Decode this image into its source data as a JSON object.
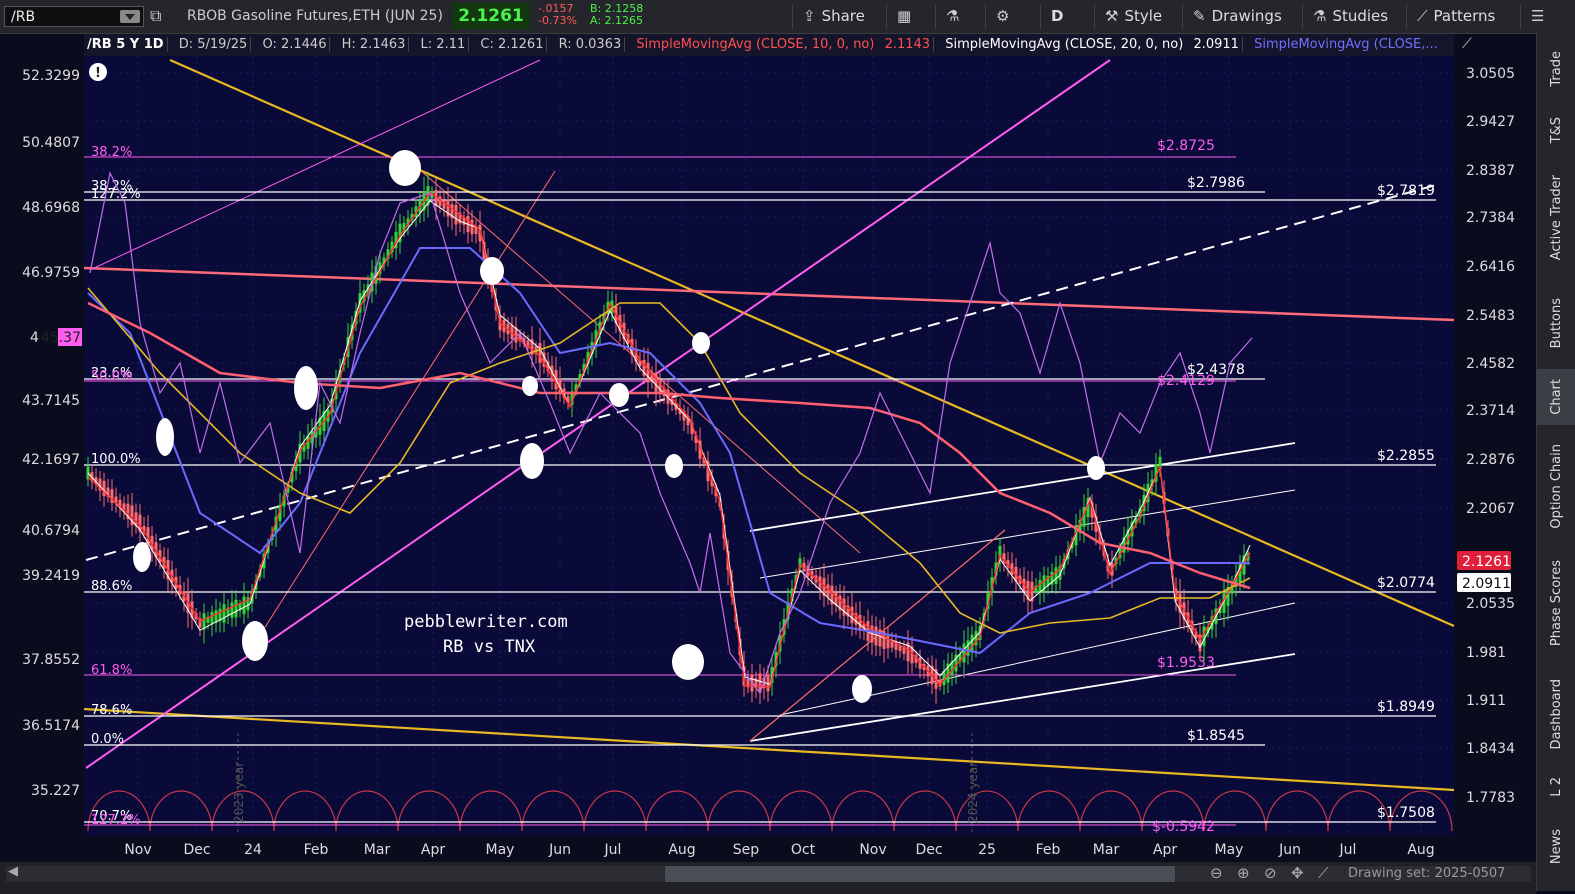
{
  "toolbar": {
    "symbol": "/RB",
    "description": "RBOB Gasoline Futures,ETH (JUN 25)",
    "last_price": "2.1261",
    "net_change": "-.0157",
    "pct_change": "-0.73%",
    "bid": "B: 2.1258",
    "ask": "A: 2.1265",
    "share": "Share",
    "aggregation": "D",
    "style": "Style",
    "drawings": "Drawings",
    "studies": "Studies",
    "patterns": "Patterns"
  },
  "header": {
    "title": "/RB 5 Y 1D",
    "date": "D: 5/19/25",
    "open": "O: 2.1446",
    "high": "H: 2.1463",
    "low": "L: 2.11",
    "close": "C: 2.1261",
    "range": "R: 0.0363",
    "sma10": "SimpleMovingAvg (CLOSE, 10, 0, no)",
    "sma10_val": "2.1143",
    "sma20": "SimpleMovingAvg (CLOSE, 20, 0, no)",
    "sma20_val": "2.0911",
    "sma_more": "SimpleMovingAvg (CLOSE,..."
  },
  "chart": {
    "left_axis": [
      "52.3299",
      "50.4807",
      "48.6968",
      "46.9759",
      "43.7145",
      "42.1697",
      "40.6794",
      "39.2419",
      "37.8552",
      "36.5174",
      "35.227"
    ],
    "left_marker": "45.37",
    "right_axis": [
      "3.0505",
      "2.9427",
      "2.8387",
      "2.7384",
      "2.6416",
      "2.5483",
      "2.4582",
      "2.3714",
      "2.2876",
      "2.2067",
      "2.0535",
      "1.981",
      "1.911",
      "1.8434",
      "1.7783"
    ],
    "price_tag": "2.1261",
    "sma_tag": "2.0911",
    "x_axis": [
      "Nov",
      "Dec",
      "24",
      "Feb",
      "Mar",
      "Apr",
      "May",
      "Jun",
      "Jul",
      "Aug",
      "Sep",
      "Oct",
      "Nov",
      "Dec",
      "25",
      "Feb",
      "Mar",
      "Apr",
      "May",
      "Jun",
      "Jul",
      "Aug"
    ],
    "year_labels": [
      "2023 year",
      "2024 year"
    ],
    "fib_white": [
      {
        "label": "38.2%",
        "right": "$2.7986"
      },
      {
        "label": "127.2%",
        "right": "$2.7819"
      },
      {
        "label": "23.6%",
        "right": "$2.4378"
      },
      {
        "label": "100.0%",
        "right": "$2.2855"
      },
      {
        "label": "88.6%",
        "right": "$2.0774"
      },
      {
        "label": "78.6%",
        "right": "$1.8949"
      },
      {
        "label": "0.0%",
        "right": "$1.8545"
      },
      {
        "label": "70.7%",
        "right": "$1.7508"
      }
    ],
    "fib_pink": [
      {
        "label": "38.2%",
        "right": "$2.8725"
      },
      {
        "label": "50.0%",
        "right": "$2.4129"
      },
      {
        "label": "61.8%",
        "right": "$1.9533"
      },
      {
        "label": "127.2%",
        "right": "$-0.5942"
      }
    ],
    "watermark_1": "pebblewriter.com",
    "watermark_2": "RB vs TNX"
  },
  "sidebar": [
    "Trade",
    "T&S",
    "Active Trader",
    "Buttons",
    "Chart",
    "Option Chain",
    "Phase Scores",
    "Dashboard",
    "L 2",
    "News"
  ],
  "footer": {
    "drawing_set": "Drawing set: 2025-0507"
  },
  "colors": {
    "bg": "#0b0b1e",
    "up": "#35d435",
    "down": "#ff6b6b",
    "gold": "#e8b923",
    "pink": "#ff5cf0",
    "sma_blue": "#6a6aff",
    "sma_red": "#ff6b6b"
  }
}
